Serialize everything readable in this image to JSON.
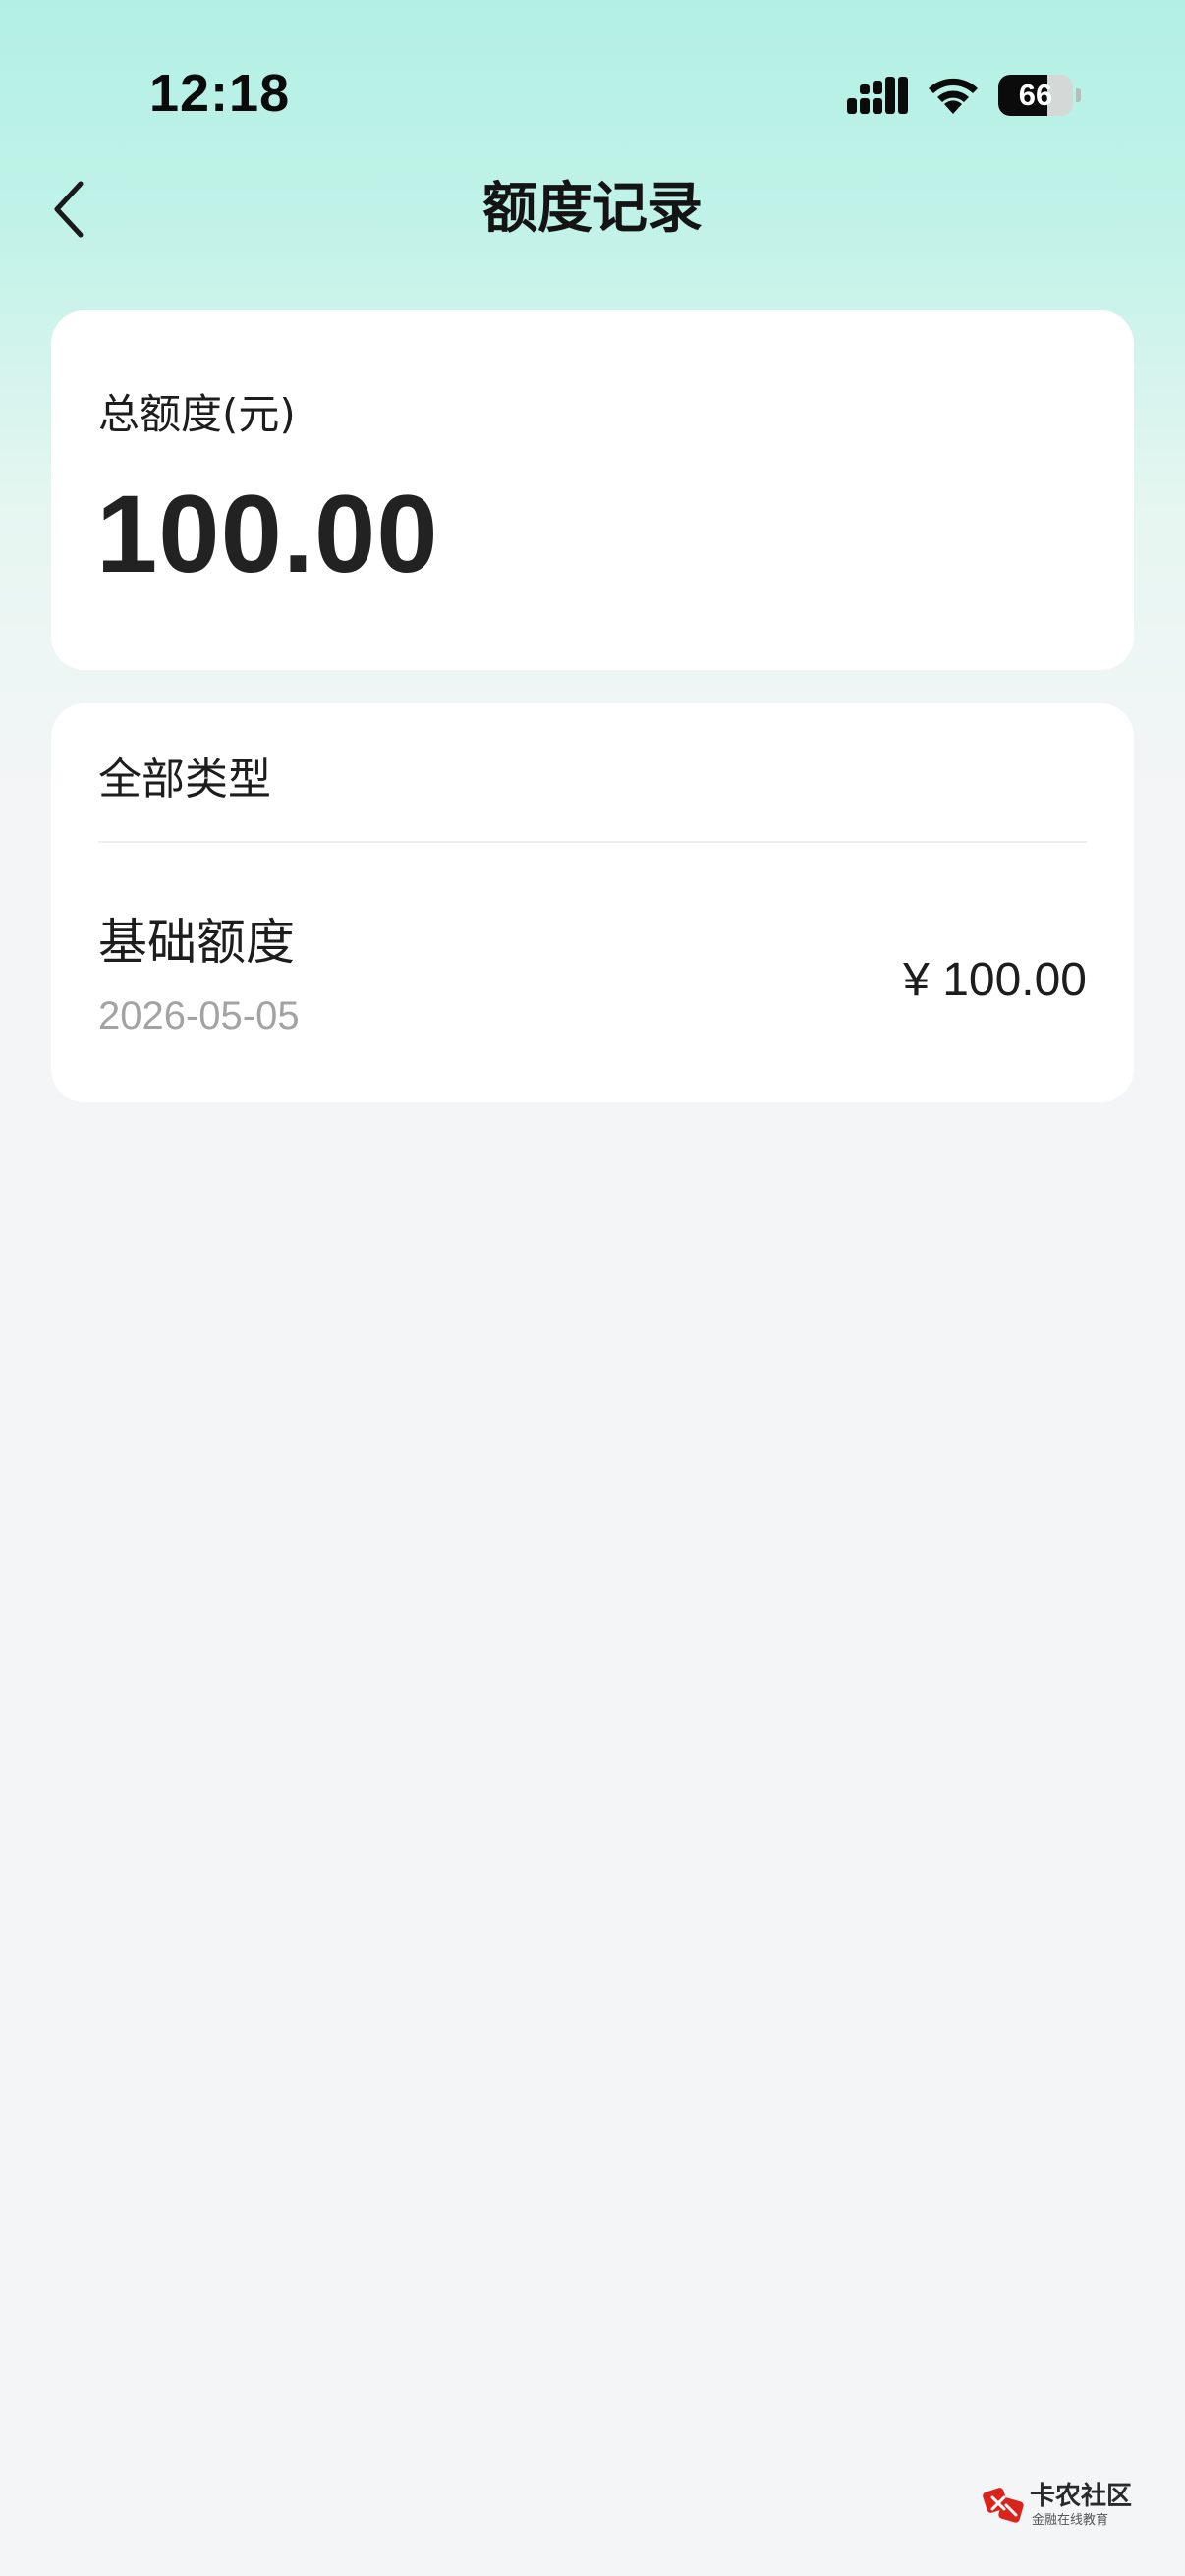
{
  "status_bar": {
    "time": "12:18",
    "battery_level": "66",
    "battery_fraction": 0.66,
    "icons": [
      "cellular-signal-icon",
      "wifi-icon",
      "battery-icon"
    ]
  },
  "nav": {
    "back_icon": "chevron-left-icon",
    "title": "额度记录"
  },
  "total": {
    "label": "总额度(元)",
    "amount": "100.00"
  },
  "records": {
    "filter_label": "全部类型",
    "items": [
      {
        "title": "基础额度",
        "date": "2026-05-05",
        "amount": "¥ 100.00"
      }
    ]
  },
  "watermark": {
    "name": "卡农社区",
    "slogan": "金融在线教育",
    "logo_icon": "kanong-logo-icon"
  },
  "colors": {
    "header_gradient_top": "#b3f0e4",
    "page_background": "#f4f5f7",
    "card_background": "#ffffff",
    "secondary_text": "#a3a3a3",
    "logo_red": "#d9241b"
  }
}
